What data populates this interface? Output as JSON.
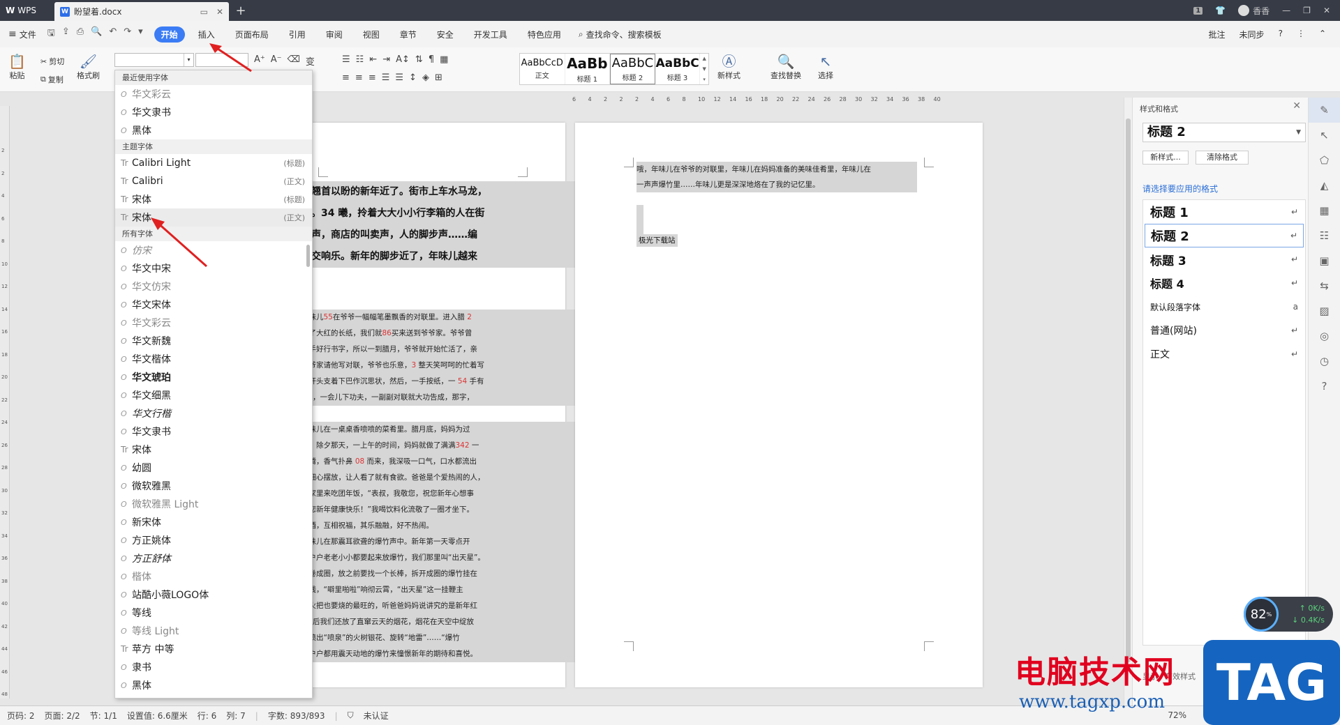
{
  "titlebar": {
    "app_name": "WPS",
    "doc_tab": "盼望着.docx",
    "user_name": "香香",
    "badge": "1"
  },
  "menubar": {
    "file_label": "文件",
    "items": [
      {
        "label": "开始",
        "active": true
      },
      {
        "label": "插入"
      },
      {
        "label": "页面布局"
      },
      {
        "label": "引用"
      },
      {
        "label": "审阅"
      },
      {
        "label": "视图"
      },
      {
        "label": "章节"
      },
      {
        "label": "安全"
      },
      {
        "label": "开发工具"
      },
      {
        "label": "特色应用"
      }
    ],
    "search_label": "查找命令、搜索模板",
    "right": {
      "comment": "批注",
      "sync": "未同步"
    }
  },
  "ribbon": {
    "paste": "粘贴",
    "cut": "剪切",
    "copy": "复制",
    "format_painter": "格式刷",
    "styles": [
      {
        "preview": "AaBbCcD",
        "name": "正文"
      },
      {
        "preview": "AaBb",
        "name": "标题 1"
      },
      {
        "preview": "AaBbC",
        "name": "标题 2"
      },
      {
        "preview": "AaBbC",
        "name": "标题 3"
      }
    ],
    "new_style": "新样式",
    "find_replace": "查找替换",
    "select": "选择"
  },
  "ruler": {
    "marks": [
      "6",
      "4",
      "2",
      "2",
      "2",
      "4",
      "6",
      "8",
      "10",
      "12",
      "14",
      "16",
      "18",
      "20",
      "22",
      "24",
      "26",
      "28",
      "30",
      "32",
      "34",
      "36",
      "38",
      "40"
    ]
  },
  "vruler": {
    "marks": [
      "2",
      "2",
      "4",
      "6",
      "8",
      "10",
      "12",
      "14",
      "16",
      "18",
      "20",
      "22",
      "24",
      "26",
      "28",
      "30",
      "32",
      "34",
      "36",
      "38",
      "40",
      "42",
      "44",
      "46",
      "48"
    ]
  },
  "font_dropdown": {
    "sections": {
      "recent": "最近使用字体",
      "theme": "主题字体",
      "all": "所有字体"
    },
    "recent": [
      {
        "name": "华文彩云"
      },
      {
        "name": "华文隶书"
      },
      {
        "name": "黑体"
      }
    ],
    "theme": [
      {
        "name": "Calibri Light",
        "tag": "(标题)"
      },
      {
        "name": "Calibri",
        "tag": "(正文)"
      },
      {
        "name": "宋体",
        "tag": "(标题)"
      },
      {
        "name": "宋体",
        "tag": "(正文)"
      }
    ],
    "all": [
      {
        "name": "仿宋"
      },
      {
        "name": "华文中宋"
      },
      {
        "name": "华文仿宋"
      },
      {
        "name": "华文宋体"
      },
      {
        "name": "华文彩云"
      },
      {
        "name": "华文新魏"
      },
      {
        "name": "华文楷体"
      },
      {
        "name": "华文琥珀"
      },
      {
        "name": "华文细黑"
      },
      {
        "name": "华文行楷"
      },
      {
        "name": "华文隶书"
      },
      {
        "name": "宋体"
      },
      {
        "name": "幼圆"
      },
      {
        "name": "微软雅黑"
      },
      {
        "name": "微软雅黑 Light"
      },
      {
        "name": "新宋体"
      },
      {
        "name": "方正姚体"
      },
      {
        "name": "方正舒体"
      },
      {
        "name": "楷体"
      },
      {
        "name": "站酷小薇LOGO体"
      },
      {
        "name": "等线"
      },
      {
        "name": "等线 Light"
      },
      {
        "name": "苹方 中等"
      },
      {
        "name": "隶书"
      },
      {
        "name": "黑体"
      }
    ]
  },
  "page1": {
    "heading_lines": [
      "…翘首以盼的新年近了。街市上车水马龙，",
      "闹。34 曦，拎着大大小小行李箱的人在街",
      "笛声，商店的叫卖声，人的脚步声……编",
      "的交响乐。新年的脚步近了，年味儿越来"
    ],
    "body_lines": [
      "年味儿55在爷爷一幅幅笔墨飘香的对联里。进入腊 2",
      "起了大红的长纸，我们就86买来送到爷爷家。爷爷曾",
      "一手好行书字，所以一到腊月，爷爷就开始忙活了，亲",
      "爷爷家请他写对联，爷爷也乐意，3 整天笑呵呵的忙着写",
      "笔杆头支着下巴作沉思状，然后，一手按纸，一 54 手有",
      "啊”，一会儿下功夫，一副副对联就大功告成，那字，",
      "",
      "年味儿在一桌桌香喷喷的菜肴里。腊月底，妈妈为过",
      "天。除夕那天，一上午的时间，妈妈就做了满满342 一",
      "腾腾，香气扑鼻 08 而来，我深吸一口气，口水都流出",
      "妈细心摆放，让人看了就有食欲。爸爸是个爱热闹的人，",
      "到家里来吃团年饭，“表叔，我敬您，祝您新年心想事",
      "祝您新年健康快乐！”我喝饮料化流敬了一圈才坐下。",
      "敬酒，互相祝福，其乐融融，好不热闹。",
      "年味儿在那震耳欲聋的爆竹声中。新年第一天零点开",
      "家户户老老小小都要起来放爆竹，我们那里叫“出天星”。",
      "，卷成圈，放之前要找一个长棒，拆开成圈的爆竹挂在",
      "火线，“噼里啪啦”响彻云霄，“出天星”这一挂鞭主",
      "点火把也要烧的最旺的，听爸爸妈妈说讲究的是新年红",
      "星”后我们还放了直窜云天的烟花，烟花在天空中绽放",
      "能喷出“喷泉”的火树银花、旋转“地雷”……“爆竹",
      "家户户都用震天动地的爆竹来憧憬新年的期待和喜悦。"
    ]
  },
  "page2": {
    "lines": [
      "哦，年味儿在爷爷的对联里，年味儿在妈妈准备的美味佳肴里，年味儿在",
      "一声声爆竹里……年味儿更是深深地烙在了我的记忆里。"
    ],
    "last": "极光下载站"
  },
  "style_panel": {
    "title": "样式和格式",
    "current": "标题 2",
    "new_style_btn": "新样式...",
    "clear_btn": "清除格式",
    "hint": "请选择要应用的格式",
    "items": [
      {
        "name": "标题 1",
        "ret": "↵"
      },
      {
        "name": "标题 2",
        "ret": "↵"
      },
      {
        "name": "标题 3",
        "ret": "↵"
      },
      {
        "name": "标题 4",
        "ret": "↵"
      },
      {
        "name": "默认段落字体",
        "ret": "a"
      },
      {
        "name": "普通(网站)",
        "ret": "↵"
      },
      {
        "name": "正文",
        "ret": "↵"
      }
    ],
    "bottom_show": "显示",
    "bottom_value": "有效样式"
  },
  "speed_widget": {
    "percent": "82",
    "unit": "%",
    "up": "0K/s",
    "down": "0.4K/s"
  },
  "statusbar": {
    "page_no": "页码: 2",
    "pages": "页面: 2/2",
    "section": "节: 1/1",
    "setting": "设置值: 6.6厘米",
    "row": "行: 6",
    "col": "列: 7",
    "words": "字数: 893/893",
    "cert": "未认证",
    "zoom": "72%"
  },
  "watermark": {
    "title": "电脑技术网",
    "url": "www.tagxp.com",
    "tag": "TAG"
  }
}
